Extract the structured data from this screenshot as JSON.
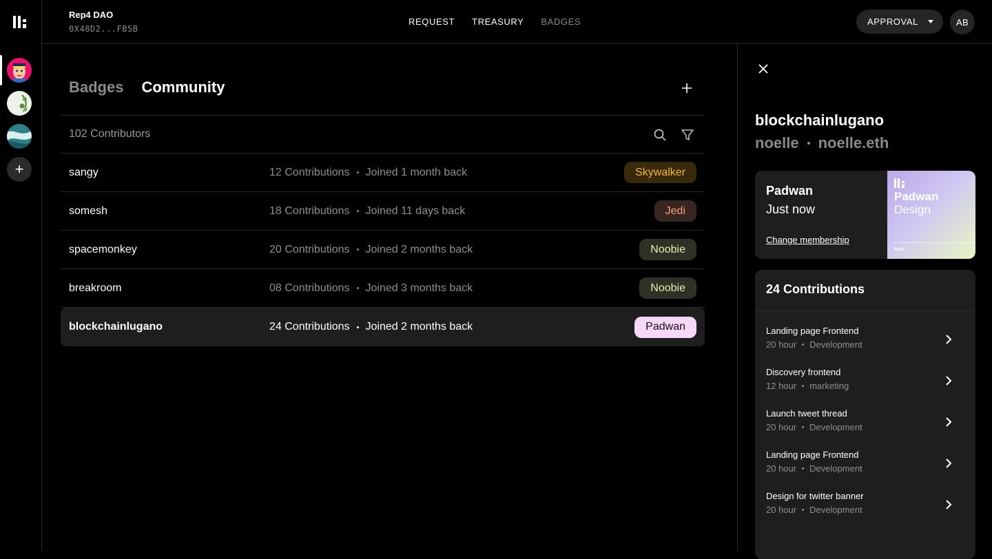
{
  "app": {
    "dao_name": "Rep4 DAO",
    "dao_address": "0X48D2...FB5B"
  },
  "nav": {
    "request": "REQUEST",
    "treasury": "TREASURY",
    "badges": "BADGES"
  },
  "topbar": {
    "approval": "APPROVAL",
    "user_initials": "AB"
  },
  "rail": {
    "add_symbol": "+"
  },
  "tabs": {
    "badges": "Badges",
    "community": "Community"
  },
  "list": {
    "count_label": "102 Contributors",
    "rows": [
      {
        "name": "sangy",
        "contributions": "12 Contributions",
        "joined": "Joined 1 month back",
        "badge": "Skywalker"
      },
      {
        "name": "somesh",
        "contributions": "18 Contributions",
        "joined": "Joined 11 days back",
        "badge": "Jedi"
      },
      {
        "name": "spacemonkey",
        "contributions": "20 Contributions",
        "joined": "Joined 2 months back",
        "badge": "Noobie"
      },
      {
        "name": "breakroom",
        "contributions": "08 Contributions",
        "joined": "Joined 3 months back",
        "badge": "Noobie"
      },
      {
        "name": "blockchainlugano",
        "contributions": "24 Contributions",
        "joined": "Joined 2 months back",
        "badge": "Padwan"
      }
    ]
  },
  "badge_colors": {
    "Skywalker": {
      "bg": "#3a2a0c",
      "fg": "#f2b43c"
    },
    "Jedi": {
      "bg": "#3a2620",
      "fg": "#f0a07a"
    },
    "Noobie": {
      "bg": "#2e3226",
      "fg": "#e0efb0"
    },
    "Padwan": {
      "bg": "#f8d8f8",
      "fg": "#111111"
    }
  },
  "panel": {
    "name": "blockchainlugano",
    "alias": "noelle",
    "ens": "noelle.eth",
    "membership": {
      "title": "Padwan",
      "time": "Just now",
      "link": "Change membership",
      "art_title": "Padwan",
      "art_subtitle": "Design",
      "art_footer": "Rep3"
    },
    "contributions_title": "24 Contributions",
    "contributions": [
      {
        "title": "Landing page Frontend",
        "hours": "20 hour",
        "category": "Development"
      },
      {
        "title": "Discovery frontend",
        "hours": "12 hour",
        "category": "marketing"
      },
      {
        "title": "Launch tweet thread",
        "hours": "20 hour",
        "category": "Development"
      },
      {
        "title": "Landing page Frontend",
        "hours": "20 hour",
        "category": "Development"
      },
      {
        "title": "Design for twitter banner",
        "hours": "20 hour",
        "category": "Development"
      }
    ]
  }
}
